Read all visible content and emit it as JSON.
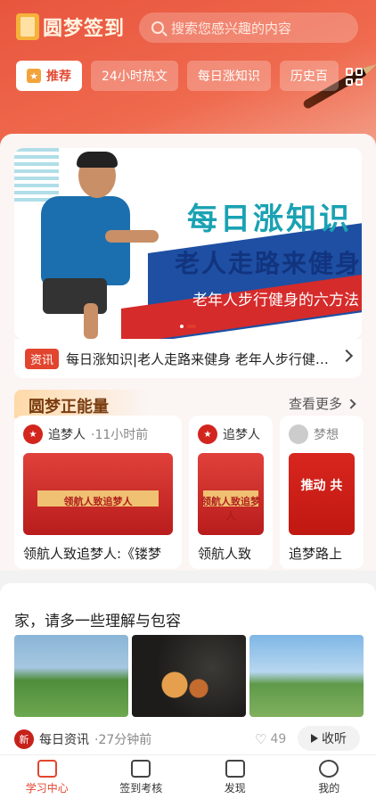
{
  "header": {
    "app_title": "圆梦签到",
    "search_placeholder": "搜索您感兴趣的内容"
  },
  "tabs": [
    {
      "label": "推荐",
      "active": true
    },
    {
      "label": "24小时热文",
      "active": false
    },
    {
      "label": "每日涨知识",
      "active": false
    },
    {
      "label": "历史百",
      "active": false
    }
  ],
  "banner": {
    "title_line1": "每日涨知识",
    "title_line2": "老人走路来健身",
    "title_line3": "老年人步行健身的六方法",
    "tag": "资讯",
    "caption": "每日涨知识|老人走路来健身 老年人步行健身的六方法"
  },
  "section": {
    "title": "圆梦正能量",
    "more_label": "查看更多"
  },
  "cards": [
    {
      "author": "追梦人",
      "time": "·11小时前",
      "image_text": "领航人致追梦人",
      "title": "领航人致追梦人:《镂梦"
    },
    {
      "author": "追梦人",
      "time": "",
      "image_text": "领航人致追梦人",
      "title": "领航人致"
    },
    {
      "author": "梦想",
      "time": "",
      "image_text": "推动 共",
      "title": "追梦路上"
    }
  ],
  "article": {
    "title": "家，请多一些理解与包容",
    "source": "每日资讯",
    "time": "·27分钟前",
    "likes": "49",
    "listen_label": "收听"
  },
  "bottom_nav": [
    {
      "label": "学习中心",
      "active": true
    },
    {
      "label": "签到考核",
      "active": false
    },
    {
      "label": "发现",
      "active": false
    },
    {
      "label": "我的",
      "active": false
    }
  ],
  "colors": {
    "brand_red": "#e2452f",
    "header_gradient_start": "#e8553e"
  }
}
